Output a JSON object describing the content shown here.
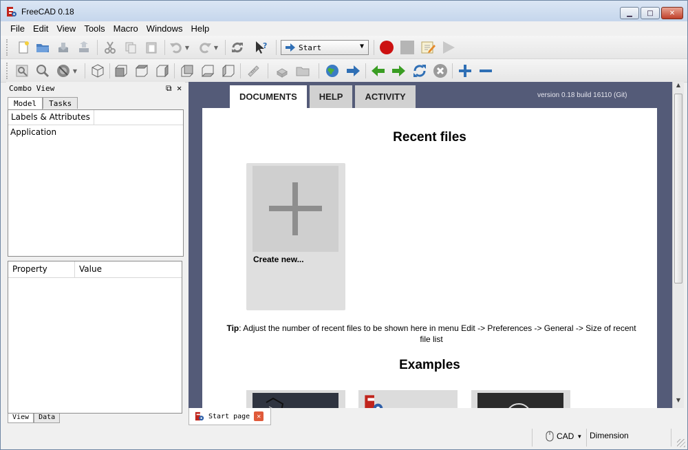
{
  "window": {
    "title": "FreeCAD 0.18",
    "minimize_glyph": "▁",
    "maximize_glyph": "□",
    "close_glyph": "✕"
  },
  "menu": [
    "File",
    "Edit",
    "View",
    "Tools",
    "Macro",
    "Windows",
    "Help"
  ],
  "toolbar": {
    "workbench_selected": "Start",
    "workbench_icon": "arrow-right-icon"
  },
  "combo_view": {
    "title": "Combo View",
    "tabs": [
      "Model",
      "Tasks"
    ],
    "tree_header": "Labels & Attributes",
    "tree_items": [
      "Application"
    ],
    "property_headers": [
      "Property",
      "Value"
    ],
    "bottom_tabs": [
      "View",
      "Data"
    ]
  },
  "start_page": {
    "tabs": [
      "DOCUMENTS",
      "HELP",
      "ACTIVITY"
    ],
    "version": "version 0.18 build 16110 (Git)",
    "recent_heading": "Recent files",
    "create_new_label": "Create new...",
    "tip_label": "Tip",
    "tip_text": ": Adjust the number of recent files to be shown here in menu Edit -> Preferences -> General -> Size of recent file list",
    "examples_heading": "Examples"
  },
  "doc_tab": {
    "label": "Start page",
    "close_glyph": "✕"
  },
  "status": {
    "nav_style": "CAD",
    "dimension": "Dimension"
  },
  "colors": {
    "mdi_background": "#545b78",
    "record": "#cc1111",
    "nav_green": "#3a9d23",
    "nav_blue": "#2f6fb5"
  }
}
